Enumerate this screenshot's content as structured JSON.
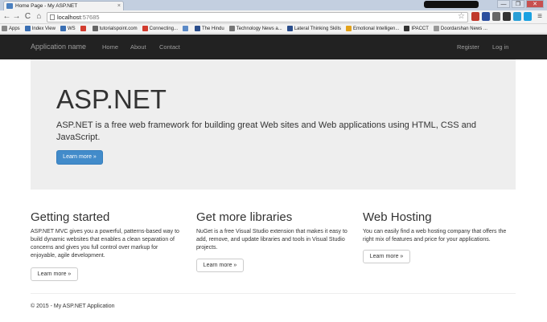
{
  "browser": {
    "tab_title": "Home Page - My ASP.NET",
    "tab_close": "×",
    "url_host": "localhost",
    "url_port": ":57685",
    "back": "←",
    "forward": "→",
    "reload": "C",
    "home": "⌂",
    "star": "☆",
    "menu": "≡",
    "minimize": "—",
    "restore": "❐",
    "close": "✕",
    "bookmarks": [
      {
        "label": "Apps",
        "icon": "apps-grid-icon",
        "color": "#888888"
      },
      {
        "label": "Index View",
        "icon": "index-view-icon",
        "color": "#3a6fb3"
      },
      {
        "label": "WS",
        "icon": "ws-icon",
        "color": "#3a6fb3"
      },
      {
        "label": "",
        "icon": "red-circle-icon",
        "color": "#d23c2f"
      },
      {
        "label": "tutorialspoint.com",
        "icon": "tutorialspoint-icon",
        "color": "#666666"
      },
      {
        "label": "Connecting...",
        "icon": "connecting-icon",
        "color": "#d23c2f"
      },
      {
        "label": "",
        "icon": "puzzle-icon",
        "color": "#5b8ac7"
      },
      {
        "label": "The Hindu",
        "icon": "the-hindu-icon",
        "color": "#2b4e8c"
      },
      {
        "label": "Technology News a...",
        "icon": "tech-news-icon",
        "color": "#777777"
      },
      {
        "label": "Lateral Thinking Skills",
        "icon": "lateral-thinking-icon",
        "color": "#2b4e8c"
      },
      {
        "label": "Emotional Intelligen...",
        "icon": "emotional-intelligence-icon",
        "color": "#e3a21a"
      },
      {
        "label": "IPACCT",
        "icon": "ipacct-icon",
        "color": "#333333"
      },
      {
        "label": "Doordarshan News ...",
        "icon": "doordarshan-icon",
        "color": "#999999"
      }
    ],
    "extensions": [
      {
        "icon": "extension-red-icon",
        "color": "#c0392b"
      },
      {
        "icon": "extension-blue-icon",
        "color": "#2c4f9e"
      },
      {
        "icon": "extension-gray-icon",
        "color": "#666666"
      },
      {
        "icon": "extension-dark-icon",
        "color": "#333333"
      },
      {
        "icon": "extension-cyan-icon",
        "color": "#2a9fd6"
      },
      {
        "icon": "skype-icon",
        "color": "#1aa1e1"
      }
    ]
  },
  "navbar": {
    "brand": "Application name",
    "links": [
      "Home",
      "About",
      "Contact"
    ],
    "register": "Register",
    "login": "Log in"
  },
  "jumbotron": {
    "title": "ASP.NET",
    "lead": "ASP.NET is a free web framework for building great Web sites and Web applications using HTML, CSS and JavaScript.",
    "button": "Learn more »"
  },
  "columns": [
    {
      "title": "Getting started",
      "text": "ASP.NET MVC gives you a powerful, patterns-based way to build dynamic websites that enables a clean separation of concerns and gives you full control over markup for enjoyable, agile development.",
      "button": "Learn more »"
    },
    {
      "title": "Get more libraries",
      "text": "NuGet is a free Visual Studio extension that makes it easy to add, remove, and update libraries and tools in Visual Studio projects.",
      "button": "Learn more »"
    },
    {
      "title": "Web Hosting",
      "text": "You can easily find a web hosting company that offers the right mix of features and price for your applications.",
      "button": "Learn more »"
    }
  ],
  "footer": {
    "text": "© 2015 - My ASP.NET Application"
  },
  "colors": {
    "navbar_bg": "#222222",
    "jumbotron_bg": "#eeeeee",
    "primary": "#428bca"
  }
}
